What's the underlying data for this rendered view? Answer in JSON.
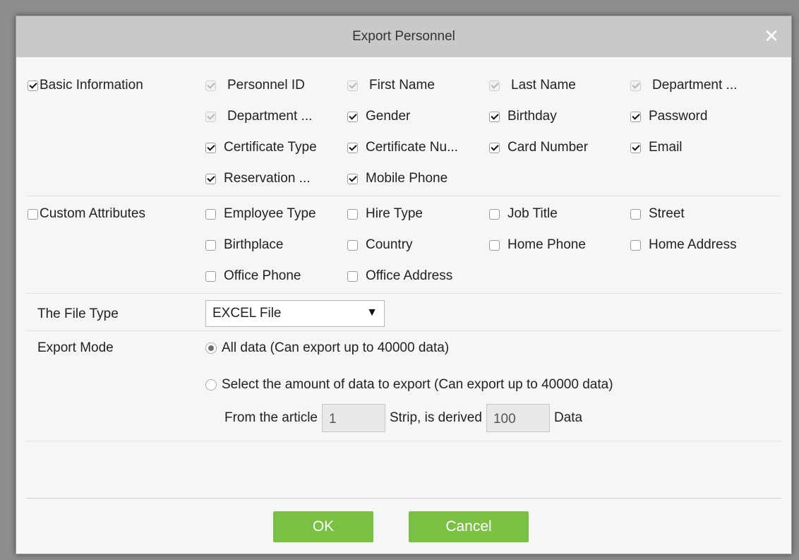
{
  "dialog": {
    "title": "Export Personnel",
    "close_glyph": "✕"
  },
  "basic_info": {
    "label": "Basic Information",
    "checked": true,
    "items": [
      {
        "label": "Personnel ID",
        "checked": true,
        "disabled": true
      },
      {
        "label": "First Name",
        "checked": true,
        "disabled": true
      },
      {
        "label": "Last Name",
        "checked": true,
        "disabled": true
      },
      {
        "label": "Department ...",
        "checked": true,
        "disabled": true
      },
      {
        "label": "Department ...",
        "checked": true,
        "disabled": true
      },
      {
        "label": "Gender",
        "checked": true,
        "disabled": false
      },
      {
        "label": "Birthday",
        "checked": true,
        "disabled": false
      },
      {
        "label": "Password",
        "checked": true,
        "disabled": false
      },
      {
        "label": "Certificate Type",
        "checked": true,
        "disabled": false
      },
      {
        "label": "Certificate Nu...",
        "checked": true,
        "disabled": false
      },
      {
        "label": "Card Number",
        "checked": true,
        "disabled": false
      },
      {
        "label": "Email",
        "checked": true,
        "disabled": false
      },
      {
        "label": "Reservation ...",
        "checked": true,
        "disabled": false
      },
      {
        "label": "Mobile Phone",
        "checked": true,
        "disabled": false
      }
    ]
  },
  "custom_attrs": {
    "label": "Custom Attributes",
    "checked": false,
    "items": [
      {
        "label": "Employee Type",
        "checked": false
      },
      {
        "label": "Hire Type",
        "checked": false
      },
      {
        "label": "Job Title",
        "checked": false
      },
      {
        "label": "Street",
        "checked": false
      },
      {
        "label": "Birthplace",
        "checked": false
      },
      {
        "label": "Country",
        "checked": false
      },
      {
        "label": "Home Phone",
        "checked": false
      },
      {
        "label": "Home Address",
        "checked": false
      },
      {
        "label": "Office Phone",
        "checked": false
      },
      {
        "label": "Office Address",
        "checked": false
      }
    ]
  },
  "file_type": {
    "label": "The File Type",
    "value": "EXCEL File",
    "arrow_glyph": "▼"
  },
  "export_mode": {
    "label": "Export Mode",
    "option_all": "All data (Can export up to 40000 data)",
    "option_amount": "Select the amount of data to export (Can export up to 40000 data)",
    "selected": "all",
    "from_label": "From the article",
    "from_value": "1",
    "strip_label": "Strip, is derived",
    "count_value": "100",
    "data_label": "Data"
  },
  "buttons": {
    "ok": "OK",
    "cancel": "Cancel"
  },
  "colors": {
    "button_green": "#7ac143",
    "titlebar": "#c9c9c9"
  }
}
